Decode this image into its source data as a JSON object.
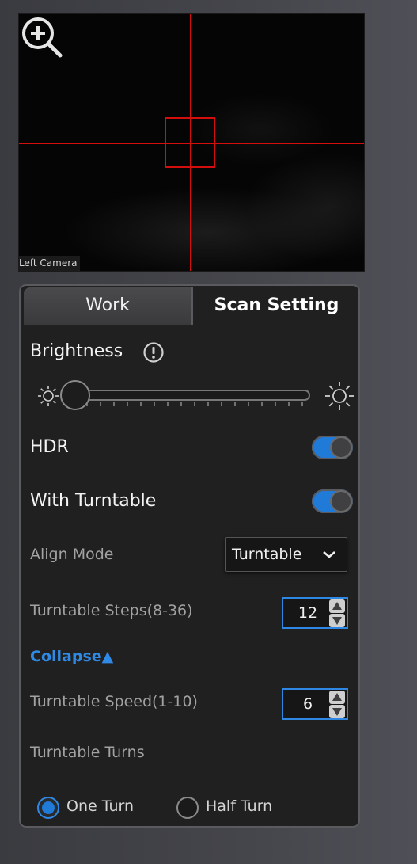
{
  "camera": {
    "label": "Left Camera",
    "zoom_icon": "zoom-in-icon",
    "crosshair_color": "#d40d0d"
  },
  "tabs": [
    {
      "label": "Work",
      "active": false
    },
    {
      "label": "Scan Setting",
      "active": true
    }
  ],
  "brightness": {
    "label": "Brightness",
    "info_icon": "info-icon",
    "value_fraction": 0.1
  },
  "hdr": {
    "label": "HDR",
    "on": true
  },
  "turntable": {
    "label": "With Turntable",
    "on": true
  },
  "align_mode": {
    "label": "Align Mode",
    "selected": "Turntable"
  },
  "turntable_steps": {
    "label": "Turntable Steps(8-36)",
    "value": "12"
  },
  "collapse": {
    "label": "Collapse▲"
  },
  "turntable_speed": {
    "label": "Turntable Speed(1-10)",
    "value": "6"
  },
  "turntable_turns": {
    "label": "Turntable Turns",
    "options": [
      {
        "label": "One Turn",
        "selected": true
      },
      {
        "label": "Half Turn",
        "selected": false
      }
    ]
  },
  "colors": {
    "accent": "#1f7ad8",
    "link": "#2f8ae6",
    "panel_bg": "#202020"
  }
}
